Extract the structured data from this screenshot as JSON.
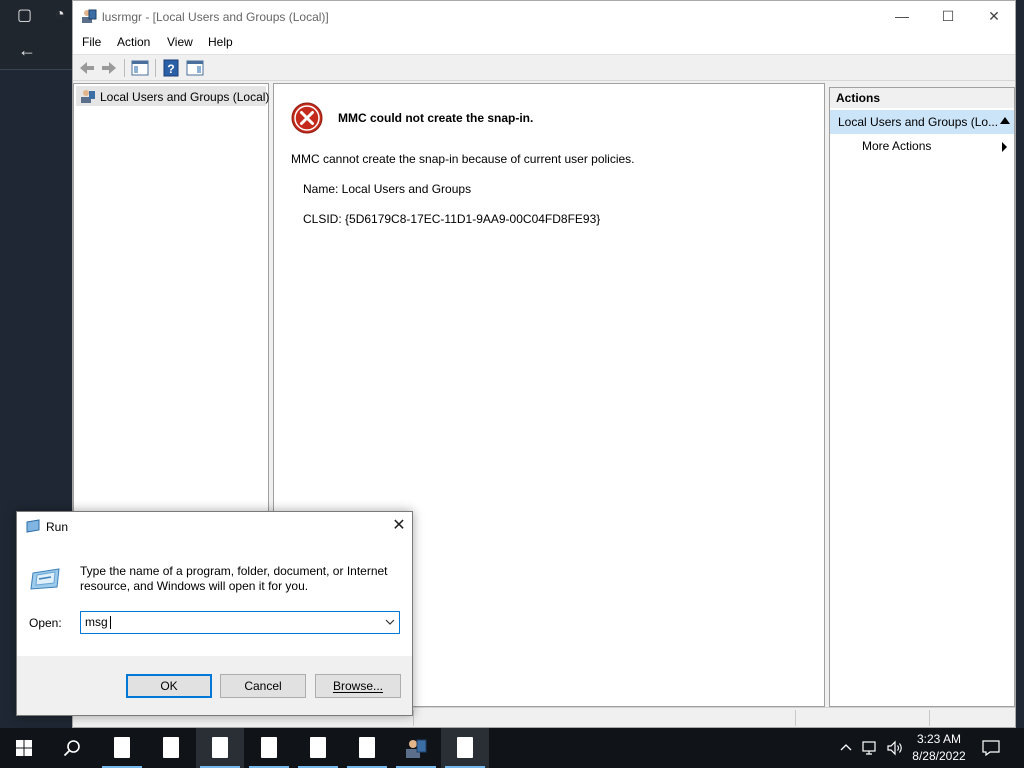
{
  "mmc": {
    "title": "lusrmgr - [Local Users and Groups (Local)]",
    "window_controls": {
      "minimize": "—",
      "maximize": "☐",
      "close": "✕"
    },
    "menu": [
      "File",
      "Action",
      "View",
      "Help"
    ],
    "tree": {
      "item": "Local Users and Groups (Local)"
    },
    "error": {
      "title": "MMC could not create the snap-in.",
      "message": "MMC cannot create the snap-in because of current user policies.",
      "name": "Name: Local Users and Groups",
      "clsid": "CLSID: {5D6179C8-17EC-11D1-9AA9-00C04FD8FE93}"
    },
    "actions": {
      "header": "Actions",
      "section": "Local Users and Groups (Lo...",
      "more": "More Actions"
    }
  },
  "run": {
    "title": "Run",
    "close": "✕",
    "description": "Type the name of a program, folder, document, or Internet resource, and Windows will open it for you.",
    "open_label": "Open:",
    "input_value": "msg",
    "buttons": {
      "ok": "OK",
      "cancel": "Cancel",
      "browse": "Browse..."
    }
  },
  "taskbar": {
    "time": "3:23 AM",
    "date": "8/28/2022",
    "accent": "#76b9ed"
  },
  "colors": {
    "selection": "#cce4f7",
    "focus": "#0078d7",
    "error_red": "#c42b1c"
  }
}
